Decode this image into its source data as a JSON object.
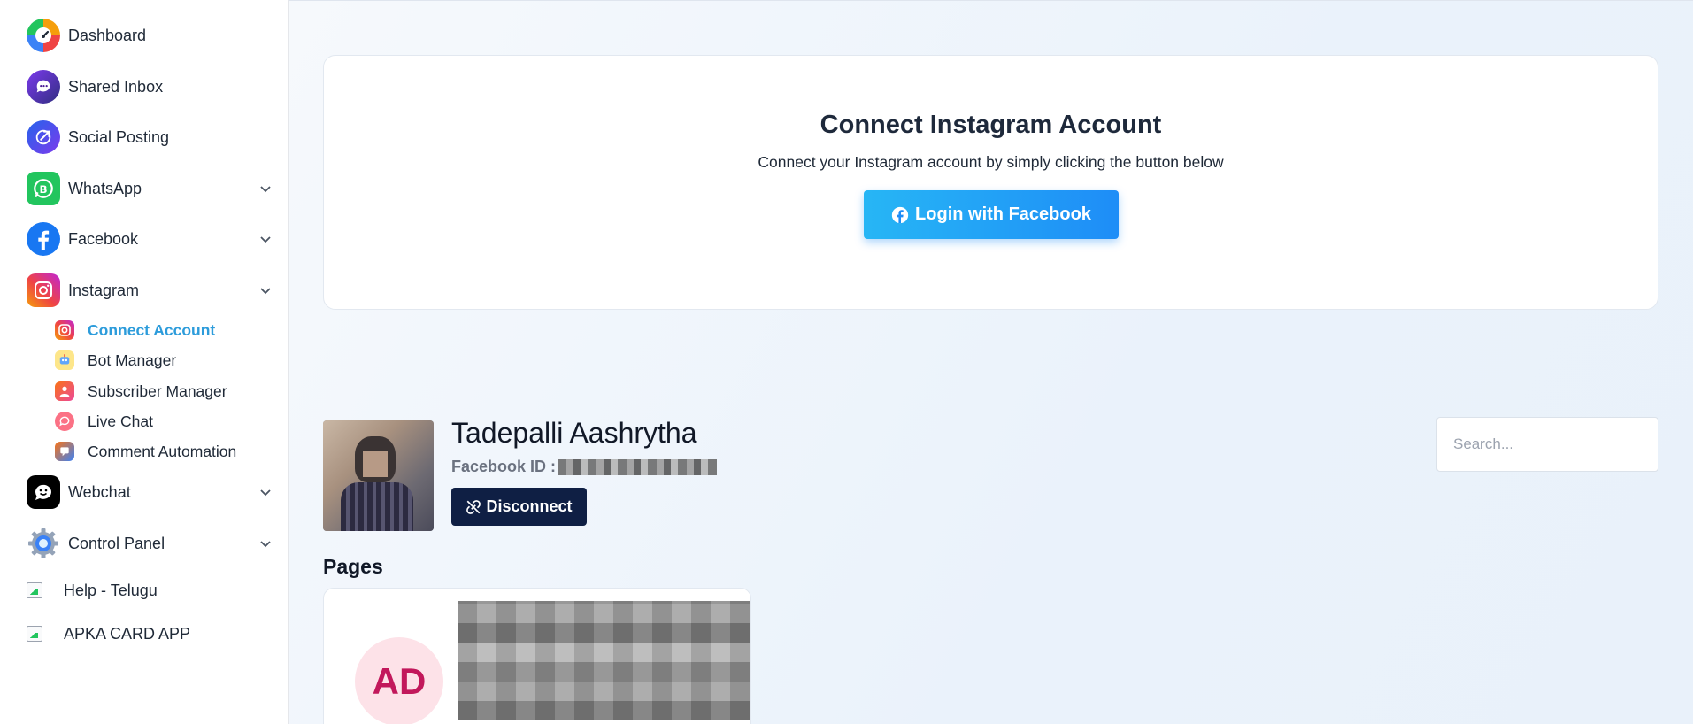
{
  "sidebar": {
    "items": [
      {
        "label": "Dashboard",
        "icon": "speedometer-icon"
      },
      {
        "label": "Shared Inbox",
        "icon": "chat-bubble-icon"
      },
      {
        "label": "Social Posting",
        "icon": "send-icon"
      },
      {
        "label": "WhatsApp",
        "icon": "whatsapp-icon"
      },
      {
        "label": "Facebook",
        "icon": "facebook-icon"
      },
      {
        "label": "Instagram",
        "icon": "instagram-icon"
      },
      {
        "label": "Webchat",
        "icon": "webchat-icon"
      },
      {
        "label": "Control Panel",
        "icon": "gear-icon"
      }
    ],
    "instagram_sub": [
      {
        "label": "Connect Account",
        "active": true
      },
      {
        "label": "Bot Manager"
      },
      {
        "label": "Subscriber Manager"
      },
      {
        "label": "Live Chat"
      },
      {
        "label": "Comment Automation"
      }
    ],
    "links": [
      {
        "label": "Help - Telugu"
      },
      {
        "label": "APKA CARD APP"
      }
    ]
  },
  "connect": {
    "title": "Connect Instagram Account",
    "subtitle": "Connect your Instagram account by simply clicking the button below",
    "button_label": "Login with Facebook"
  },
  "profile": {
    "name": "Tadepalli Aashrytha",
    "facebook_id_label": "Facebook ID :",
    "disconnect_label": "Disconnect"
  },
  "search": {
    "placeholder": "Search..."
  },
  "pages": {
    "heading": "Pages",
    "cards": [
      {
        "initials": "AD"
      }
    ]
  },
  "colors": {
    "accent": "#2d9cdb",
    "login_button": "#1e8df7",
    "disconnect_button": "#0f1f44",
    "page_avatar_bg": "#fde2e8",
    "page_avatar_text": "#c2185b"
  }
}
